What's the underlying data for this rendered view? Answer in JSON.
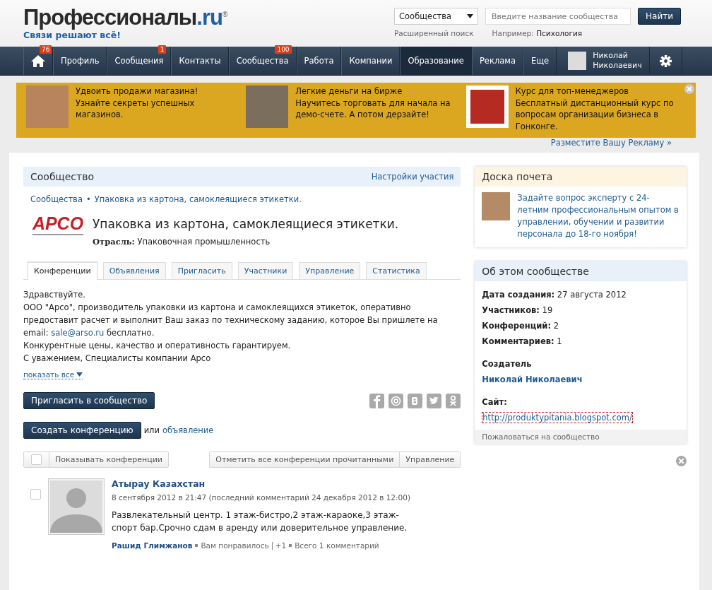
{
  "header": {
    "logo": "Профессионалы",
    "logo_tld": ".ru",
    "logo_mark": "®",
    "tagline": "Связи решают всё!",
    "search": {
      "dropdown": "Сообщества",
      "placeholder": "Введите название сообщества",
      "button": "Найти",
      "advanced": "Расширенный поиск",
      "example_label": "Например:",
      "example": "Психология"
    }
  },
  "nav": {
    "items": [
      {
        "kind": "home",
        "badge": "76",
        "selected": false
      },
      {
        "kind": "text",
        "label": "Профиль",
        "selected": false
      },
      {
        "kind": "text",
        "label": "Сообщения",
        "badge": "1",
        "selected": false
      },
      {
        "kind": "text",
        "label": "Контакты",
        "selected": false
      },
      {
        "kind": "text",
        "label": "Сообщества",
        "badge": "100",
        "selected": false
      },
      {
        "kind": "text",
        "label": "Работа",
        "selected": false
      },
      {
        "kind": "text",
        "label": "Компании",
        "selected": false
      },
      {
        "kind": "text",
        "label": "Образование",
        "selected": true
      },
      {
        "kind": "text",
        "label": "Реклама",
        "selected": false
      },
      {
        "kind": "text",
        "label": "Еще",
        "selected": false
      }
    ],
    "user": {
      "first_name": "Николай",
      "last_name": "Николаевич"
    }
  },
  "ads": {
    "items": [
      {
        "title": "Удвоить продажи магазина!",
        "text": "Узнайте секреты успешных магазинов."
      },
      {
        "title": "Легкие деньги на бирже",
        "text": "Научитесь торговать для начала на демо-счете. А потом дерзайте!"
      },
      {
        "title": "Курс для топ-менеджеров",
        "text": "Бесплатный дистанционный курс по вопросам организации бизнеса в Гонконге."
      }
    ],
    "place_ad": "Разместите Вашу Рекламу »"
  },
  "community": {
    "header": "Сообщество",
    "settings": "Настройки участия",
    "breadcrumbs": [
      "Сообщества",
      "Упаковка из картона, самоклеящиеся этикетки."
    ],
    "breadcrumb_separator": "•",
    "logo_text": "АРСО",
    "name": "Упаковка из картона, самоклеящиеся этикетки.",
    "industry_label": "Отрасль:",
    "industry": "Упаковочная промышленность",
    "tabs": [
      {
        "label": "Конференции",
        "selected": true
      },
      {
        "label": "Объявления",
        "selected": false
      },
      {
        "label": "Пригласить",
        "selected": false
      },
      {
        "label": "Участники",
        "selected": false
      },
      {
        "label": "Управление",
        "selected": false
      },
      {
        "label": "Статистика",
        "selected": false
      }
    ],
    "description": {
      "greeting": "Здравствуйте.",
      "body": "ООО \"Арсо\", производитель упаковки из картона и самоклеящихся этикеток, оперативно предоставит расчет и выполнит Ваш заказ по техническому заданию, которое Вы пришлете на email:",
      "email": "sale@arso.ru",
      "body_end": "бесплатно.",
      "line2": "Конкурентные цены, качество и оперативность гарантируем.",
      "line3": "С уважением, Специалисты компании Арсо"
    },
    "show_all": "показать все",
    "invite": "Пригласить в сообщество",
    "share": [
      {
        "kind": "facebook"
      },
      {
        "kind": "mail"
      },
      {
        "kind": "vk"
      },
      {
        "kind": "twitter"
      },
      {
        "kind": "ok"
      }
    ],
    "create": "Создать конференцию",
    "or": "или",
    "announcement": "объявление",
    "toolbar": {
      "checked": false,
      "show": "Показывать конференции",
      "mark_read": "Отметить все конференции прочитанными",
      "manage": "Управление"
    },
    "posts": [
      {
        "checked": false,
        "title": "Атырау Казахстан",
        "date": "8 сентября 2012 в 21:47 (последний комментарий 24 декабря 2012 в 12:00)",
        "text": "Развлекательный центр. 1 этаж-бистро,2 этаж-караоке,3 этаж-спорт бар.Срочно сдам в аренду или доверительное управление.",
        "author": "Рашид Глимжанов",
        "liked": "Вам понравилось",
        "plus": "+1",
        "comments": "Всего 1 комментарий"
      }
    ]
  },
  "sidebar": {
    "honor": {
      "title": "Доска почета",
      "text": "Задайте вопрос эксперту с 24-летним профессиональным опытом в управлении, обучении и развитии персонала до 18-го ноября!"
    },
    "about": {
      "title": "Об этом сообществе",
      "facts": [
        {
          "label": "Дата создания:",
          "value": "27 августа 2012"
        },
        {
          "label": "Участников:",
          "value": "19"
        },
        {
          "label": "Конференций:",
          "value": "2"
        },
        {
          "label": "Комментариев:",
          "value": "1"
        }
      ],
      "creator_label": "Создатель",
      "creator": "Николай Николаевич",
      "site_label": "Сайт:",
      "site": "http://produktypitania.blogspot.com/",
      "complain": "Пожаловаться на сообщество"
    }
  }
}
